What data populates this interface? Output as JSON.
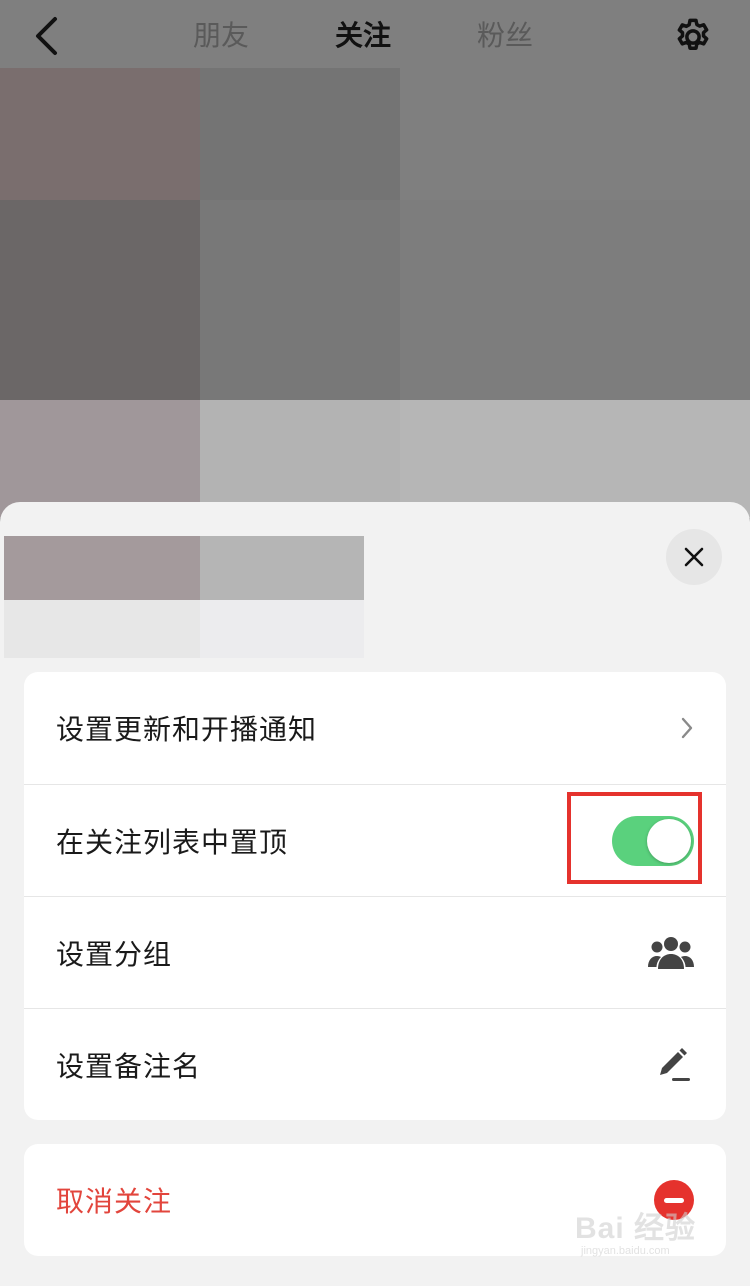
{
  "nav": {
    "tabs": [
      {
        "label": "朋友",
        "active": false
      },
      {
        "label": "关注",
        "active": true
      },
      {
        "label": "粉丝",
        "active": false
      }
    ],
    "back_icon": "chevron-left-icon",
    "settings_icon": "gear-icon"
  },
  "sheet": {
    "close_icon": "close-icon",
    "menu": [
      {
        "label": "设置更新和开播通知",
        "right": "chevron-right-icon"
      },
      {
        "label": "在关注列表中置顶",
        "right": "toggle",
        "toggle_on": true
      },
      {
        "label": "设置分组",
        "right": "group-icon"
      },
      {
        "label": "设置备注名",
        "right": "pencil-icon"
      }
    ],
    "unfollow": {
      "label": "取消关注",
      "icon": "minus-circle-icon"
    }
  },
  "colors": {
    "toggle_on": "#5ad17d",
    "danger": "#e2453c",
    "highlight": "#e5322d"
  },
  "watermark": {
    "text": "Bai 经验",
    "sub": "jingyan.baidu.com"
  }
}
